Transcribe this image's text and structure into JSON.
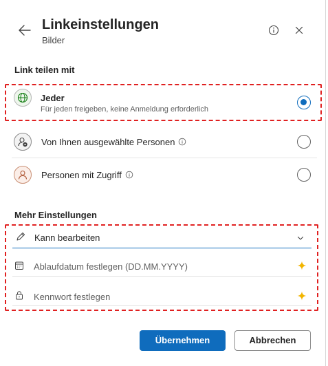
{
  "header": {
    "title": "Linkeinstellungen",
    "subtitle": "Bilder"
  },
  "share_section": {
    "heading": "Link teilen mit",
    "options": [
      {
        "title": "Jeder",
        "description": "Für jeden freigeben, keine Anmeldung erforderlich",
        "selected": true,
        "icon": "globe-icon"
      },
      {
        "title": "Von Ihnen ausgewählte Personen",
        "selected": false,
        "icon": "people-settings-icon"
      },
      {
        "title": "Personen mit Zugriff",
        "selected": false,
        "icon": "person-icon"
      }
    ]
  },
  "more_settings": {
    "heading": "Mehr Einstellungen",
    "permission_value": "Kann bearbeiten",
    "expiry_placeholder": "Ablaufdatum festlegen (DD.MM.YYYY)",
    "password_placeholder": "Kennwort festlegen"
  },
  "footer": {
    "apply_label": "Übernehmen",
    "cancel_label": "Abbrechen"
  },
  "colors": {
    "accent": "#0f6cbd",
    "highlight_border": "#e02020",
    "premium_star": "#f2b500"
  }
}
